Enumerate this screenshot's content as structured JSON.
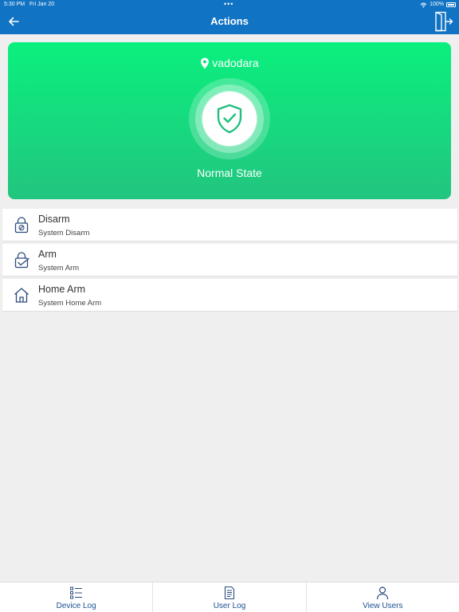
{
  "status_bar": {
    "time": "5:30 PM",
    "date": "Fri Jan 20",
    "dots": "•••",
    "battery": "100%"
  },
  "nav": {
    "title": "Actions",
    "back_icon": "arrow-left-icon",
    "exit_icon": "exit-door-icon"
  },
  "hero": {
    "location": "vadodara",
    "state": "Normal State",
    "colors": {
      "gradient_top": "#0af07e",
      "gradient_bottom": "#22c57f",
      "shield": "#22bf7f"
    }
  },
  "actions": [
    {
      "title": "Disarm",
      "subtitle": "System Disarm",
      "icon": "unlock-icon"
    },
    {
      "title": "Arm",
      "subtitle": "System Arm",
      "icon": "lock-check-icon"
    },
    {
      "title": "Home Arm",
      "subtitle": "System Home Arm",
      "icon": "home-icon"
    }
  ],
  "tabs": [
    {
      "label": "Device Log",
      "icon": "list-icon"
    },
    {
      "label": "User Log",
      "icon": "document-icon"
    },
    {
      "label": "View Users",
      "icon": "user-icon"
    }
  ],
  "colors": {
    "nav_bar": "#1173c4",
    "background": "#efefef",
    "icon_stroke": "#2c4c7e",
    "tab_label": "#1a4f8f"
  }
}
